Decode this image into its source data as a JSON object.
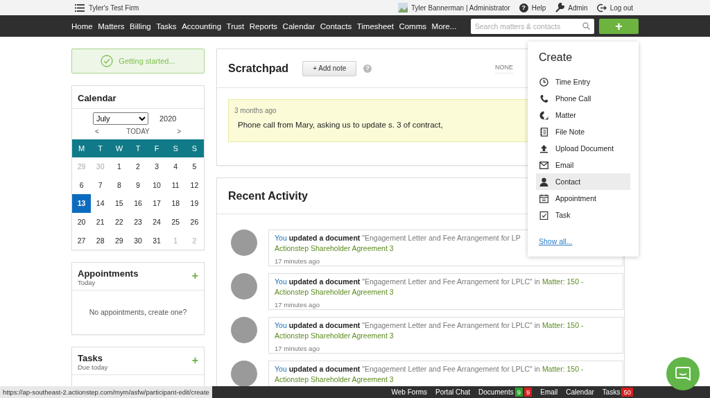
{
  "top_bar": {
    "firm": "Tyler's Test Firm",
    "user": "Tyler Bannerman | Administrator",
    "links": [
      {
        "kind": "help",
        "icon": "?",
        "label": "Help"
      },
      {
        "kind": "admin",
        "label": "Admin"
      },
      {
        "kind": "logout",
        "label": "Log out"
      }
    ]
  },
  "nav": {
    "items": [
      "Home",
      "Matters",
      "Billing",
      "Tasks",
      "Accounting",
      "Trust",
      "Reports",
      "Calendar",
      "Contacts",
      "Timesheet",
      "Comms",
      "More..."
    ],
    "search": {
      "placeholder": "Search matters & contacts"
    },
    "create_button": "+"
  },
  "getting_started": "Getting started...",
  "calendar": {
    "title": "Calendar",
    "month": "July",
    "year": "2020",
    "prev": "<",
    "today": "TODAY",
    "next": ">",
    "weekdays": [
      "M",
      "T",
      "W",
      "T",
      "F",
      "S",
      "S"
    ],
    "weeks": [
      [
        {
          "day": "29",
          "muted": true,
          "selected": false
        },
        {
          "day": "30",
          "muted": true,
          "selected": false
        },
        {
          "day": "1",
          "muted": false,
          "selected": false
        },
        {
          "day": "2",
          "muted": false,
          "selected": false
        },
        {
          "day": "3",
          "muted": false,
          "selected": false
        },
        {
          "day": "4",
          "muted": false,
          "selected": false
        },
        {
          "day": "5",
          "muted": false,
          "selected": false
        }
      ],
      [
        {
          "day": "6",
          "muted": false,
          "selected": false
        },
        {
          "day": "7",
          "muted": false,
          "selected": false
        },
        {
          "day": "8",
          "muted": false,
          "selected": false
        },
        {
          "day": "9",
          "muted": false,
          "selected": false
        },
        {
          "day": "10",
          "muted": false,
          "selected": false
        },
        {
          "day": "11",
          "muted": false,
          "selected": false
        },
        {
          "day": "12",
          "muted": false,
          "selected": false
        }
      ],
      [
        {
          "day": "13",
          "muted": false,
          "selected": true
        },
        {
          "day": "14",
          "muted": false,
          "selected": false
        },
        {
          "day": "15",
          "muted": false,
          "selected": false
        },
        {
          "day": "16",
          "muted": false,
          "selected": false
        },
        {
          "day": "17",
          "muted": false,
          "selected": false
        },
        {
          "day": "18",
          "muted": false,
          "selected": false
        },
        {
          "day": "19",
          "muted": false,
          "selected": false
        }
      ],
      [
        {
          "day": "20",
          "muted": false,
          "selected": false
        },
        {
          "day": "21",
          "muted": false,
          "selected": false
        },
        {
          "day": "22",
          "muted": false,
          "selected": false
        },
        {
          "day": "23",
          "muted": false,
          "selected": false
        },
        {
          "day": "24",
          "muted": false,
          "selected": false
        },
        {
          "day": "25",
          "muted": false,
          "selected": false
        },
        {
          "day": "26",
          "muted": false,
          "selected": false
        }
      ],
      [
        {
          "day": "27",
          "muted": false,
          "selected": false
        },
        {
          "day": "28",
          "muted": false,
          "selected": false
        },
        {
          "day": "29",
          "muted": false,
          "selected": false
        },
        {
          "day": "30",
          "muted": false,
          "selected": false
        },
        {
          "day": "31",
          "muted": false,
          "selected": false
        },
        {
          "day": "1",
          "muted": true,
          "selected": false
        },
        {
          "day": "2",
          "muted": true,
          "selected": false
        }
      ]
    ]
  },
  "appointments": {
    "title": "Appointments",
    "subtitle": "Today",
    "add": "+",
    "empty": "No appointments, create one?"
  },
  "tasks": {
    "title": "Tasks",
    "subtitle": "Due today",
    "add": "+"
  },
  "scratchpad": {
    "title": "Scratchpad",
    "add_button": "+ Add note",
    "help": "?",
    "filter": "NONE",
    "note": {
      "time": "3 months ago",
      "text": "Phone call from Mary, asking us to update s. 3 of contract,"
    }
  },
  "recent_activity": {
    "title": "Recent Activity",
    "items": [
      {
        "actor": "You",
        "action": "updated a document",
        "document": "\"Engagement Letter and Fee Arrangement for LP",
        "matter_title": "Actionstep Shareholder Agreement 3",
        "time": "17 minutes ago"
      },
      {
        "actor": "You",
        "action": "updated a document",
        "document": "\"Engagement Letter and Fee Arrangement for LPLC\"",
        "connector": "in",
        "matter_ref": "Matter: 150 -",
        "matter_title": "Actionstep Shareholder Agreement 3",
        "time": "17 minutes ago"
      },
      {
        "actor": "You",
        "action": "updated a document",
        "document": "\"Engagement Letter and Fee Arrangement for LPLC\"",
        "connector": "in",
        "matter_ref": "Matter: 150 -",
        "matter_title": "Actionstep Shareholder Agreement 3",
        "time": "17 minutes ago"
      },
      {
        "actor": "You",
        "action": "updated a document",
        "document": "\"Engagement Letter and Fee Arrangement for LPLC\"",
        "connector": "in",
        "matter_ref": "Matter: 150 -",
        "matter_title": "Actionstep Shareholder Agreement 3"
      }
    ]
  },
  "create_menu": {
    "title": "Create",
    "items": [
      {
        "kind": "time",
        "label": "Time Entry",
        "selected": false
      },
      {
        "kind": "phone",
        "label": "Phone Call",
        "selected": false
      },
      {
        "kind": "matter",
        "label": "Matter",
        "selected": false
      },
      {
        "kind": "filenote",
        "label": "File Note",
        "selected": false
      },
      {
        "kind": "upload",
        "label": "Upload Document",
        "selected": false
      },
      {
        "kind": "email",
        "label": "Email",
        "selected": false
      },
      {
        "kind": "contact",
        "label": "Contact",
        "selected": true
      },
      {
        "kind": "appointment",
        "label": "Appointment",
        "selected": false
      },
      {
        "kind": "task",
        "label": "Task",
        "selected": false
      }
    ],
    "show_all": "Show all..."
  },
  "status_bar": {
    "url": "https://ap-southeast-2.actionstep.com/mym/asfw/participant-edit/create",
    "items": [
      {
        "label": "Web Forms"
      },
      {
        "label": "Portal Chat"
      },
      {
        "label": "Documents",
        "badges": [
          {
            "count": "9",
            "color": "#2e9e2e"
          },
          {
            "count": "9",
            "color": "#d42020"
          }
        ]
      },
      {
        "label": "Email"
      },
      {
        "label": "Calendar"
      },
      {
        "label": "Tasks",
        "badges": [
          {
            "count": "50",
            "color": "#d42020"
          }
        ]
      }
    ]
  }
}
